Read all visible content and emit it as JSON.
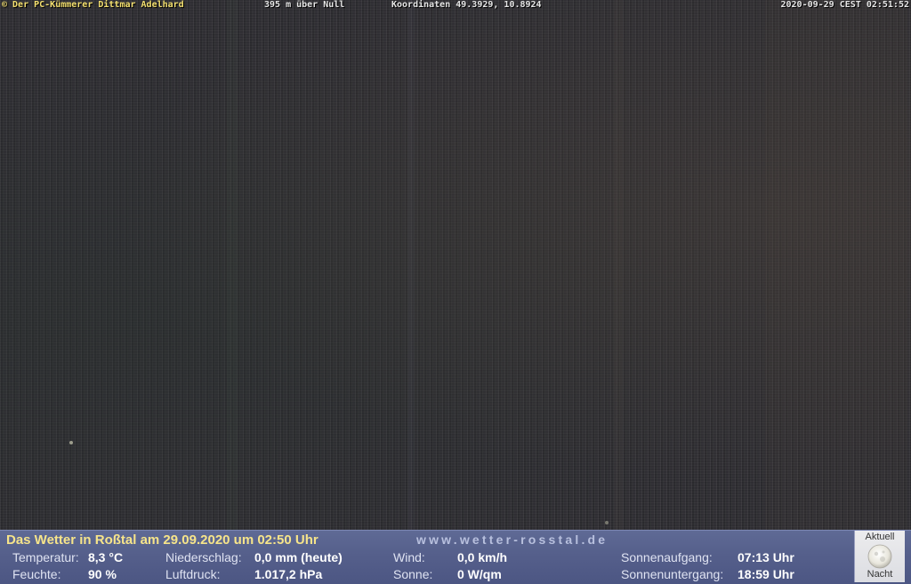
{
  "overlay": {
    "copyright": "© Der PC-Kümmerer Dittmar Adelhard",
    "altitude": "395 m über Null",
    "coordinates": "Koordinaten 49.3929, 10.8924",
    "timestamp": "2020-09-29 CEST 02:51:52"
  },
  "weather": {
    "title": "Das Wetter in Roßtal am 29.09.2020 um 02:50 Uhr",
    "website": "www.wetter-rosstal.de",
    "temperature": {
      "label": "Temperatur:",
      "value": "8,3 °C"
    },
    "humidity": {
      "label": "Feuchte:",
      "value": "90 %"
    },
    "precipitation": {
      "label": "Niederschlag:",
      "value": "0,0 mm (heute)"
    },
    "pressure": {
      "label": "Luftdruck:",
      "value": "1.017,2 hPa"
    },
    "wind": {
      "label": "Wind:",
      "value": "0,0 km/h"
    },
    "sun": {
      "label": "Sonne:",
      "value": "0 W/qm"
    },
    "sunrise": {
      "label": "Sonnenaufgang:",
      "value": "07:13 Uhr"
    },
    "sunset": {
      "label": "Sonnenuntergang:",
      "value": "18:59 Uhr"
    }
  },
  "moon_widget": {
    "top_label": "Aktuell",
    "bottom_label": "Nacht",
    "icon": "moon-icon"
  },
  "colors": {
    "panel": "#555f8b",
    "title": "#f6e48a",
    "overlay_text": "#f4e070"
  }
}
